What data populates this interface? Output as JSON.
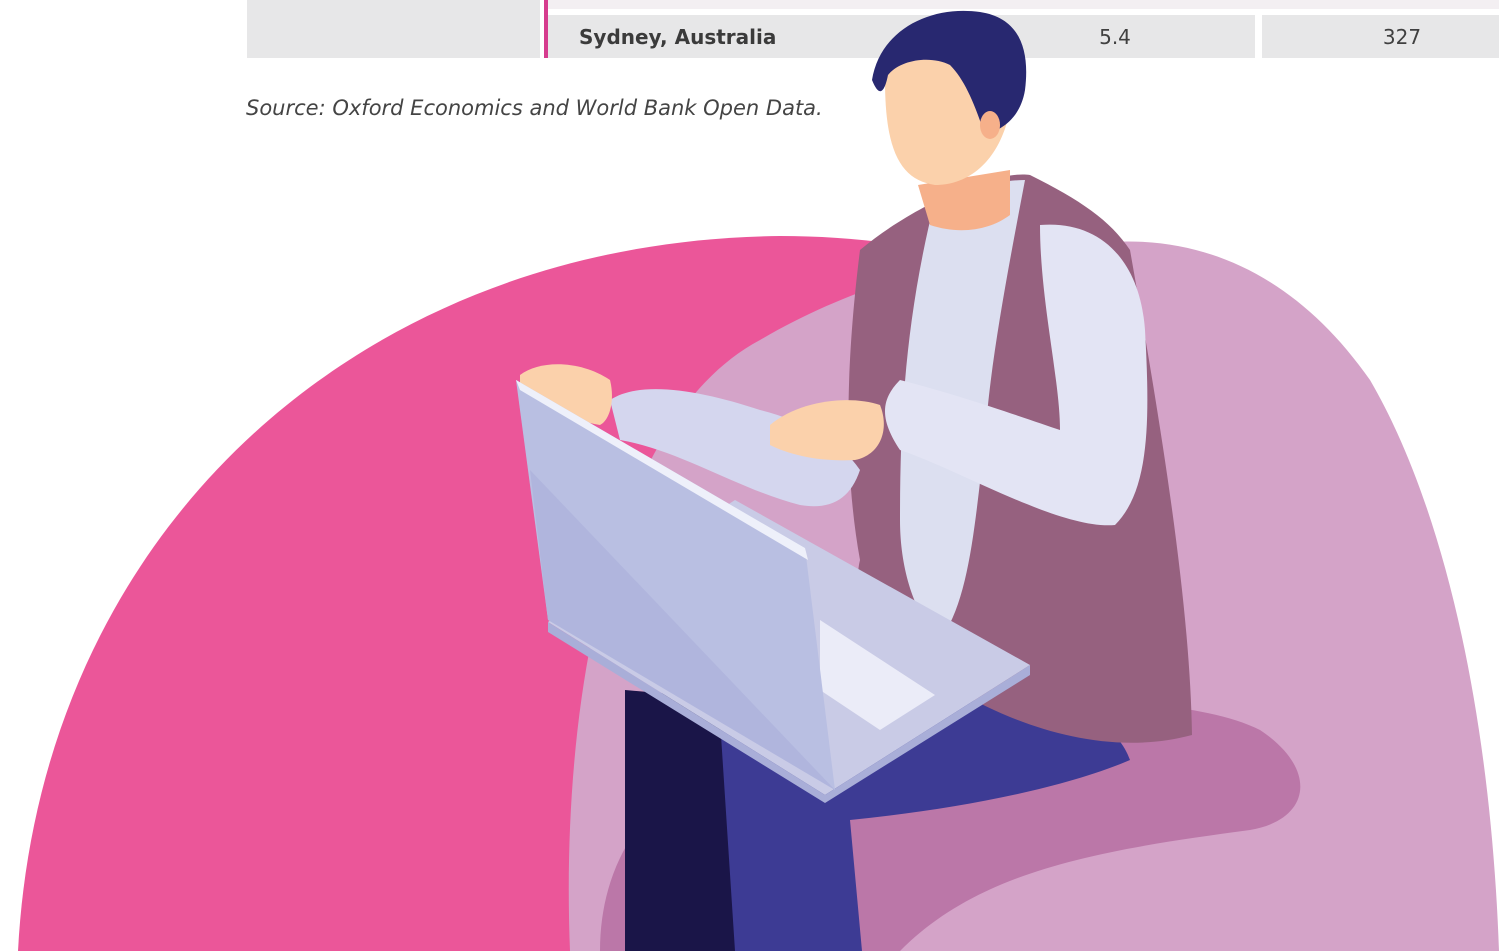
{
  "table": {
    "last_row": {
      "city": "Sydney, Australia",
      "value_1": "5.4",
      "value_2": "327"
    }
  },
  "source_note": "Source: Oxford Economics and World Bank Open Data.",
  "colors": {
    "accent": "#d63c8e",
    "pink_circle": "#eb5699",
    "chair": "#d4a3c8",
    "vest": "#96617f",
    "hair": "#282870",
    "skin": "#fbd1ab",
    "laptop": "#bcc1e2",
    "jeans": "#3d3b94",
    "shirt": "#dcdff0"
  },
  "illustration": {
    "subject": "person-with-laptop-illustration"
  }
}
